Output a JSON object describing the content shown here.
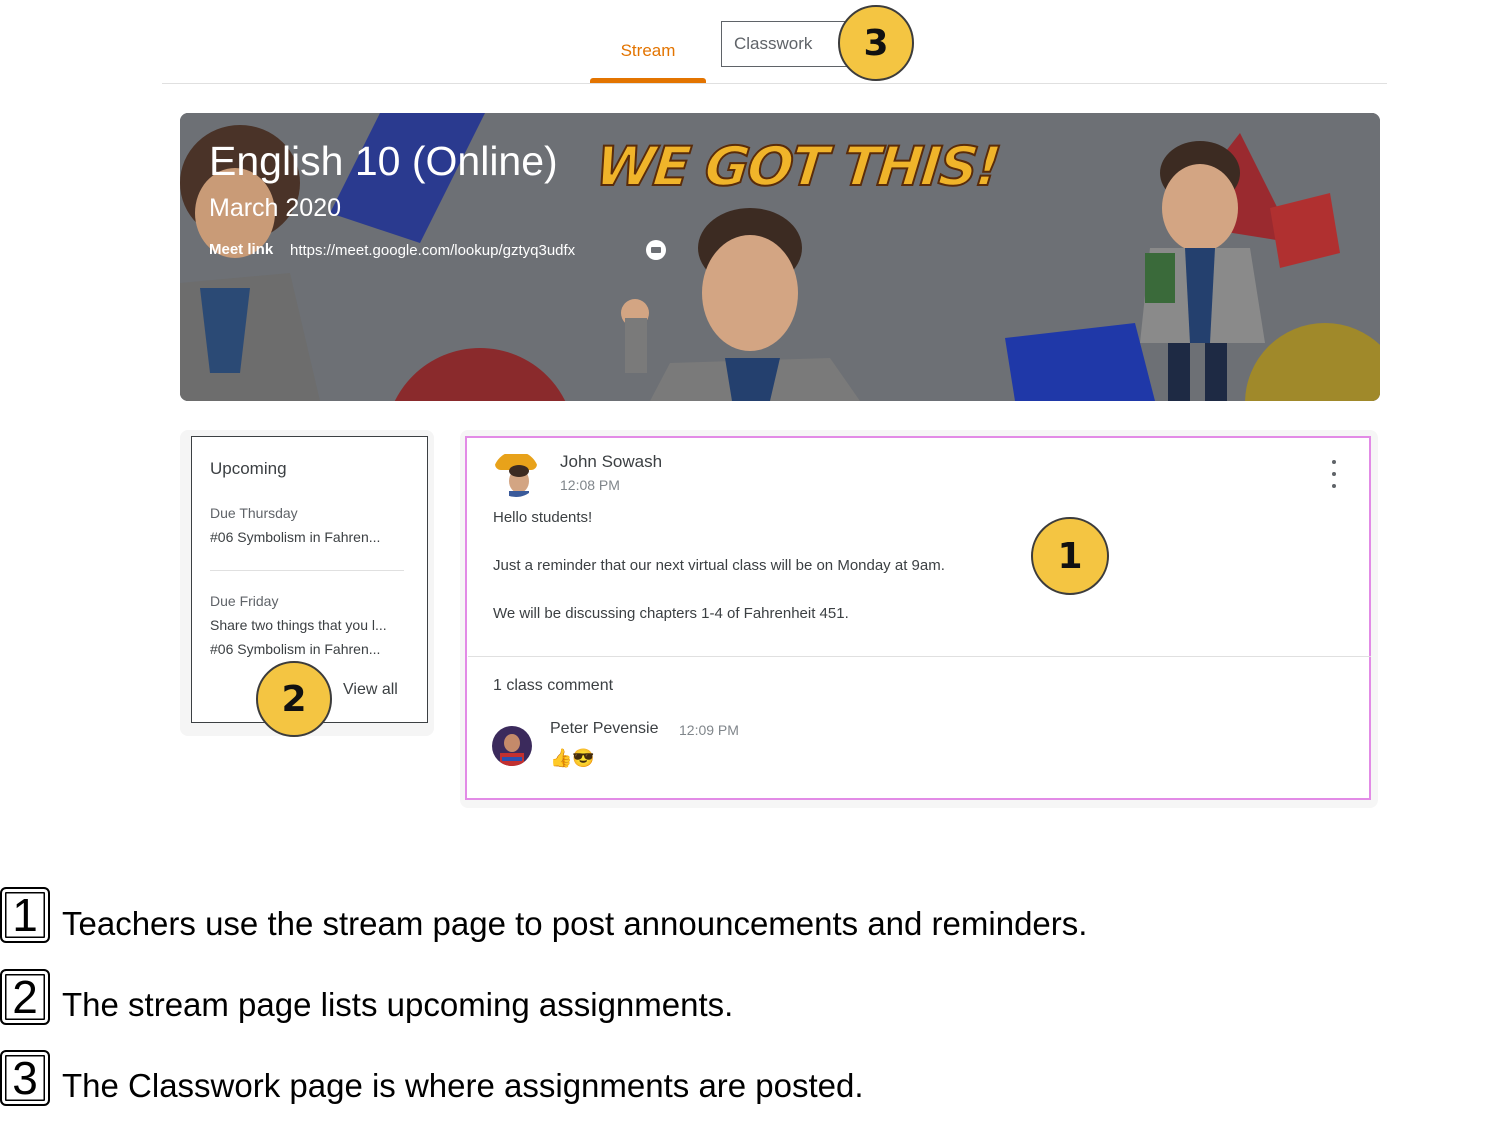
{
  "tabs": {
    "stream_label": "Stream",
    "classwork_label": "Classwork"
  },
  "banner": {
    "class_title": "English 10 (Online)",
    "class_subtitle": "March 2020",
    "meet_label": "Meet link",
    "meet_url": "https://meet.google.com/lookup/gztyq3udfx",
    "slogan": "WE GOT THIS!"
  },
  "upcoming": {
    "title": "Upcoming",
    "groups": [
      {
        "due": "Due Thursday",
        "items": [
          "#06 Symbolism in Fahren..."
        ]
      },
      {
        "due": "Due Friday",
        "items": [
          "Share two things that you l...",
          "#06 Symbolism in Fahren..."
        ]
      }
    ],
    "view_all": "View all"
  },
  "post": {
    "author": "John Sowash",
    "time": "12:08 PM",
    "lines": [
      "Hello students!",
      "Just a reminder that our next virtual class will be on Monday at 9am.",
      "We will be discussing chapters 1-4 of Fahrenheit 451."
    ],
    "comment_count": "1 class comment",
    "comment": {
      "author": "Peter Pevensie",
      "time": "12:09 PM",
      "text": "👍😎"
    }
  },
  "callouts": {
    "one": "1",
    "two": "2",
    "three": "3"
  },
  "legend": [
    {
      "number": "1",
      "text": "Teachers use the stream page to post announcements and reminders."
    },
    {
      "number": "2",
      "text": "The stream page lists upcoming assignments."
    },
    {
      "number": "3",
      "text": "The Classwork page is where assignments are posted."
    }
  ],
  "colors": {
    "accent": "#e37400",
    "callout": "#f4c542",
    "highlight_border": "#e28be6",
    "banner_bg": "#6b6e73"
  },
  "icons": [
    "copy-link-icon",
    "more-vert-icon"
  ]
}
